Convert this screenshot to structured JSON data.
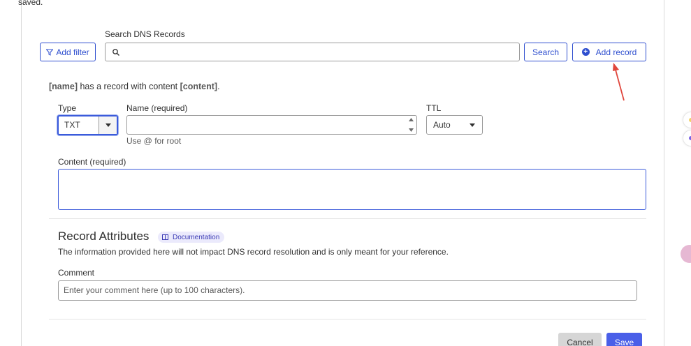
{
  "header": {
    "saved_text": "saved."
  },
  "search": {
    "label": "Search DNS Records",
    "value": "",
    "add_filter_label": "Add filter",
    "search_button_label": "Search",
    "add_record_label": "Add record"
  },
  "hint": {
    "name_token": "[name]",
    "middle": " has a record with content ",
    "content_token": "[content]",
    "end": "."
  },
  "form": {
    "type_label": "Type",
    "type_value": "TXT",
    "name_label": "Name (required)",
    "name_value": "",
    "name_help": "Use @ for root",
    "ttl_label": "TTL",
    "ttl_value": "Auto",
    "content_label": "Content (required)",
    "content_value": ""
  },
  "attributes": {
    "title": "Record Attributes",
    "doc_badge": "Documentation",
    "description": "The information provided here will not impact DNS record resolution and is only meant for your reference.",
    "comment_label": "Comment",
    "comment_placeholder": "Enter your comment here (up to 100 characters)."
  },
  "actions": {
    "cancel_label": "Cancel",
    "save_label": "Save"
  },
  "colors": {
    "accent": "#2f4fcf",
    "save_button": "#4a5fe8",
    "cancel_button": "#d6d6d6",
    "annotation_arrow": "#e0463c",
    "badge_background": "#ebeafc"
  },
  "icons": {
    "filter": "filter-icon",
    "search": "search-icon",
    "add": "plus-circle-icon",
    "dropdown": "chevron-down-icon",
    "spinner": "spinner-arrows-icon",
    "documentation": "book-icon",
    "annotation": "red-arrow-annotation"
  }
}
